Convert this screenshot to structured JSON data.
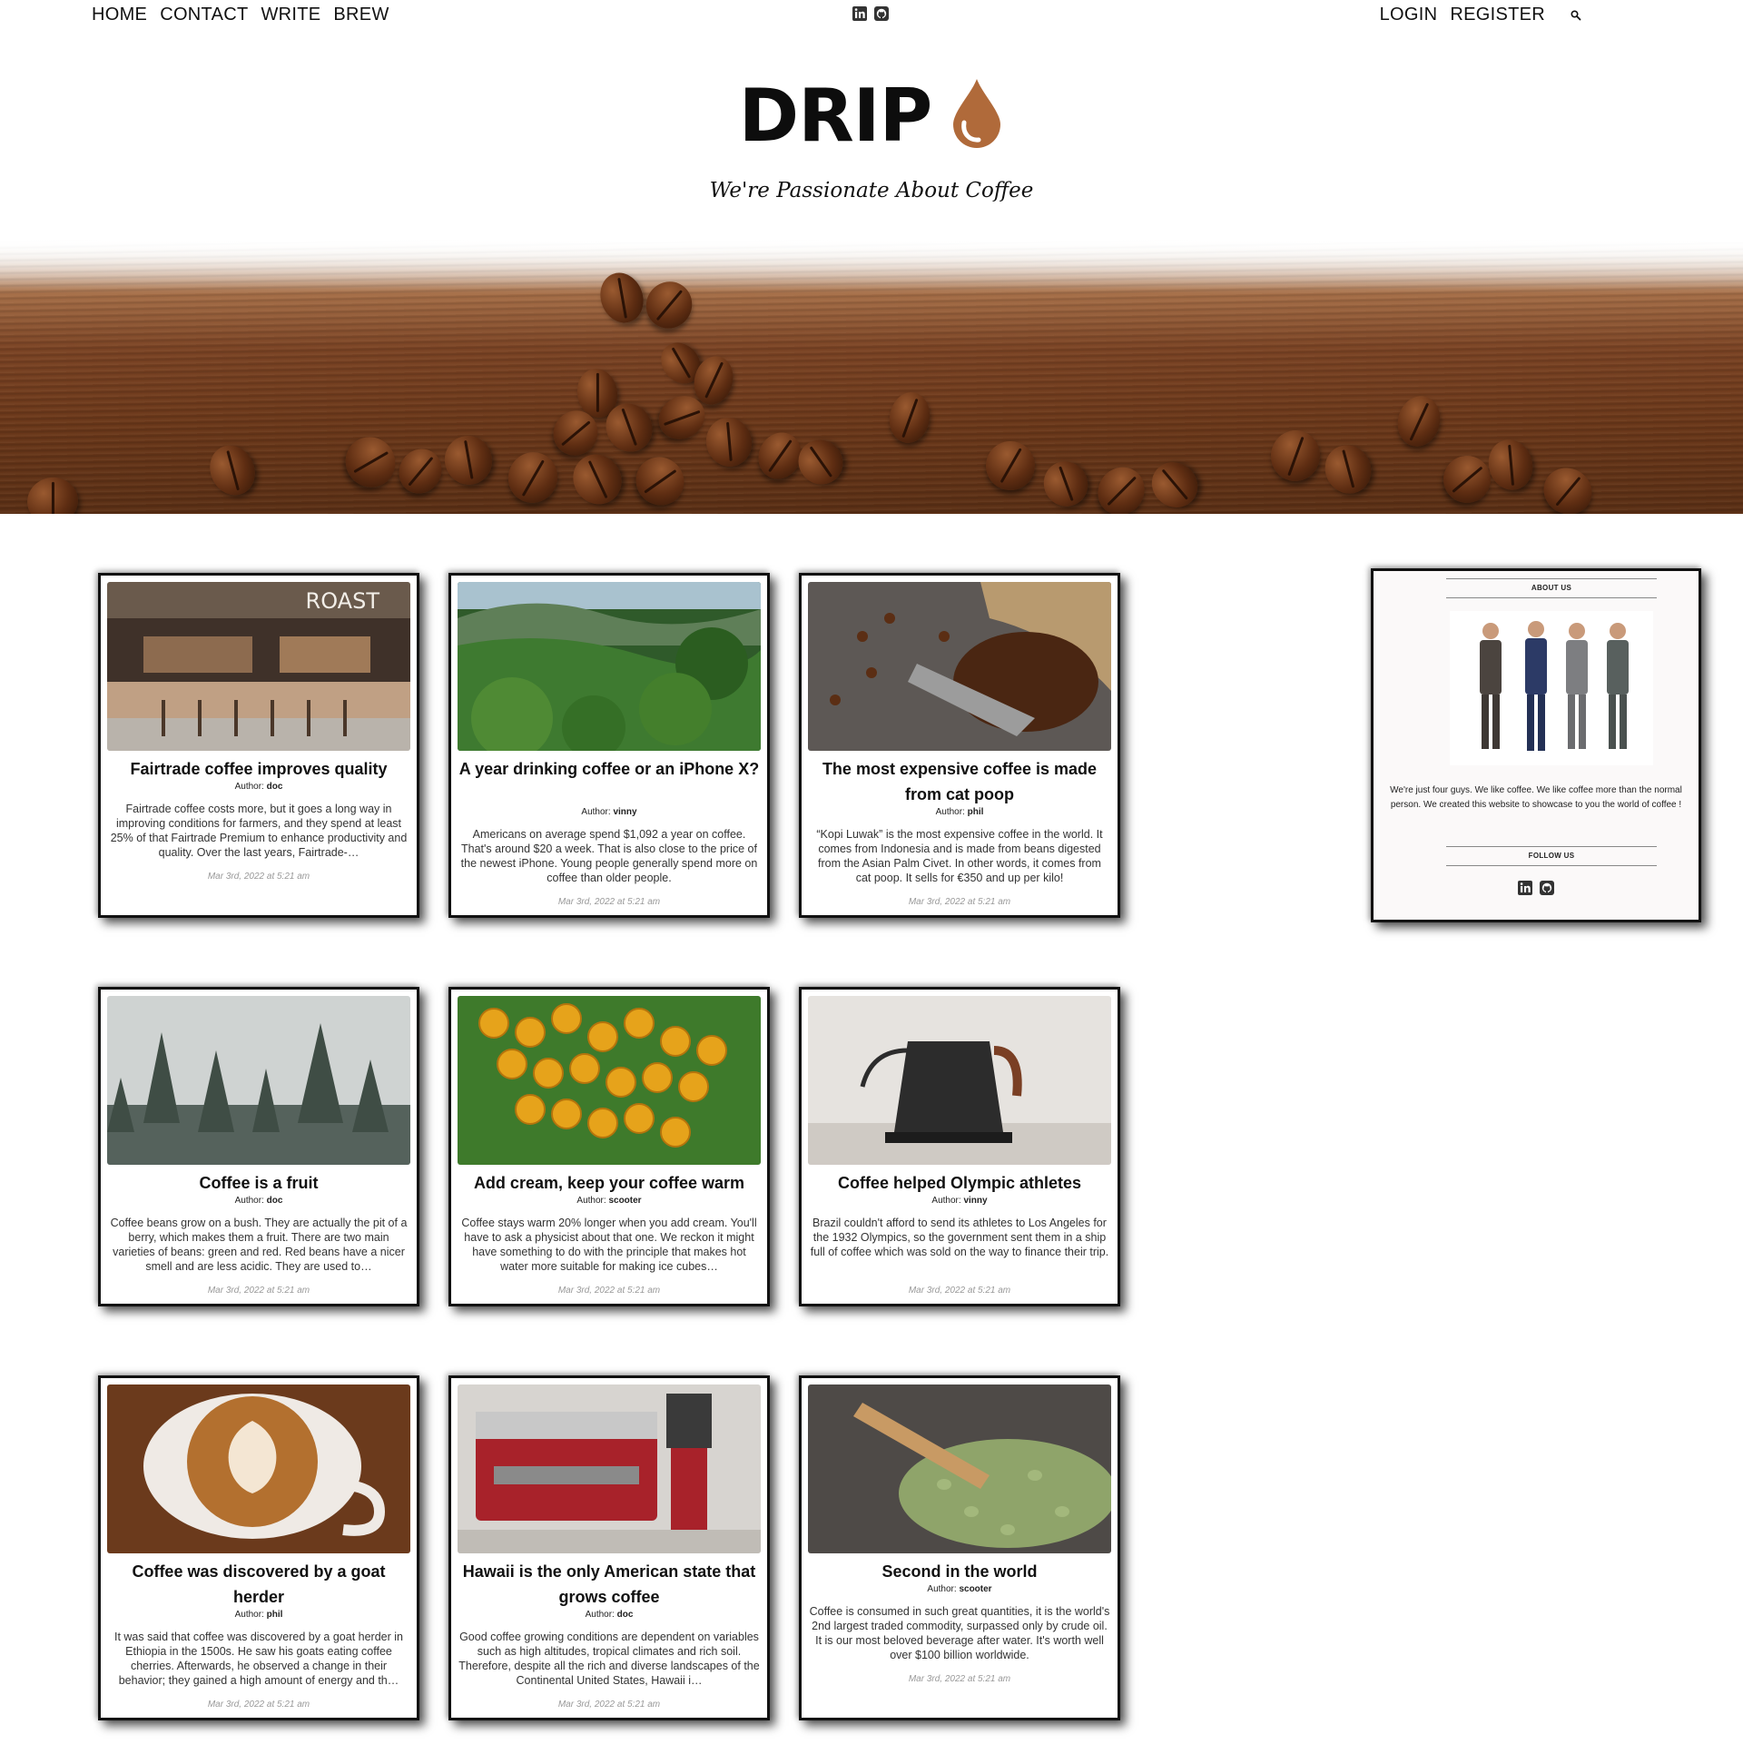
{
  "nav": {
    "left": [
      "HOME",
      "CONTACT",
      "WRITE",
      "BREW"
    ],
    "right": [
      "LOGIN",
      "REGISTER"
    ]
  },
  "social_icons": [
    "linkedin-icon",
    "github-icon"
  ],
  "header": {
    "logo": "DRIP",
    "tagline": "We're Passionate About Coffee"
  },
  "colors": {
    "accent_drop": "#b06a3a",
    "card_border": "#111111"
  },
  "posts": [
    {
      "title": "Fairtrade coffee improves quality",
      "author_label": "Author:",
      "author": "doc",
      "excerpt": "Fairtrade coffee costs more, but it goes a long way in improving conditions for farmers, and they spend at least 25% of that Fairtrade Premium to enhance productivity and quality. Over the last years, Fairtrade-…",
      "date": "Mar 3rd, 2022 at 5:21 am",
      "image": "roast-cafe"
    },
    {
      "title": "A year drinking coffee or an iPhone X?",
      "author_label": "Author:",
      "author": "vinny",
      "excerpt": "Americans on average spend $1,092 a year on coffee. That's around $20 a week. That is also close to the price of the newest iPhone. Young people generally spend more on coffee than older people.",
      "date": "Mar 3rd, 2022 at 5:21 am",
      "image": "coffee-plantation"
    },
    {
      "title": "The most expensive coffee is made from cat poop",
      "author_label": "Author:",
      "author": "phil",
      "excerpt": "“Kopi Luwak” is the most expensive coffee in the world. It comes from Indonesia and is made from beans digested from the Asian Palm Civet. In other words, it comes from cat poop. It sells for €350 and up per kilo!",
      "date": "Mar 3rd, 2022 at 5:21 am",
      "image": "beans-scoop"
    },
    {
      "title": "Coffee is a fruit",
      "author_label": "Author:",
      "author": "doc",
      "excerpt": "Coffee beans grow on a bush. They are actually the pit of a berry, which makes them a fruit. There are two main varieties of beans: green and red. Red beans have a nicer smell and are less acidic. They are used to…",
      "date": "Mar 3rd, 2022 at 5:21 am",
      "image": "misty-forest"
    },
    {
      "title": "Add cream, keep your coffee warm",
      "author_label": "Author:",
      "author": "scooter",
      "excerpt": "Coffee stays warm 20% longer when you add cream. You'll have to ask a physicist about that one. We reckon it might have something to do with the principle that makes hot water more suitable for making ice cubes…",
      "date": "Mar 3rd, 2022 at 5:21 am",
      "image": "coffee-cherries"
    },
    {
      "title": "Coffee helped Olympic athletes",
      "author_label": "Author:",
      "author": "vinny",
      "excerpt": "Brazil couldn't afford to send its athletes to Los Angeles for the 1932 Olympics, so the government sent them in a ship full of coffee which was sold on the way to finance their trip.",
      "date": "Mar 3rd, 2022 at 5:21 am",
      "image": "kettle"
    },
    {
      "title": "Coffee was discovered by a goat herder",
      "author_label": "Author:",
      "author": "phil",
      "excerpt": "It was said that coffee was discovered by a goat herder in Ethiopia in the 1500s. He saw his goats eating coffee cherries. Afterwards, he observed a change in their behavior; they gained a high amount of energy and th…",
      "date": "Mar 3rd, 2022 at 5:21 am",
      "image": "latte-art"
    },
    {
      "title": "Hawaii is the only American state that grows coffee",
      "author_label": "Author:",
      "author": "doc",
      "excerpt": "Good coffee growing conditions are dependent on variables such as high altitudes, tropical climates and rich soil. Therefore, despite all the rich and diverse landscapes of the Continental United States, Hawaii i…",
      "date": "Mar 3rd, 2022 at 5:21 am",
      "image": "espresso-machine"
    },
    {
      "title": "Second in the world",
      "author_label": "Author:",
      "author": "scooter",
      "excerpt": "Coffee is consumed in such great quantities, it is the world's 2nd largest traded commodity, surpassed only by crude oil. It is our most beloved beverage after water. It's worth well over $100 billion worldwide.",
      "date": "Mar 3rd, 2022 at 5:21 am",
      "image": "green-beans"
    }
  ],
  "sidebar": {
    "about_heading": "ABOUT US",
    "about_text": "We're just four guys. We like coffee. We like coffee more than the normal person. We created this website to showcase to you the world of coffee !",
    "follow_heading": "FOLLOW US"
  }
}
